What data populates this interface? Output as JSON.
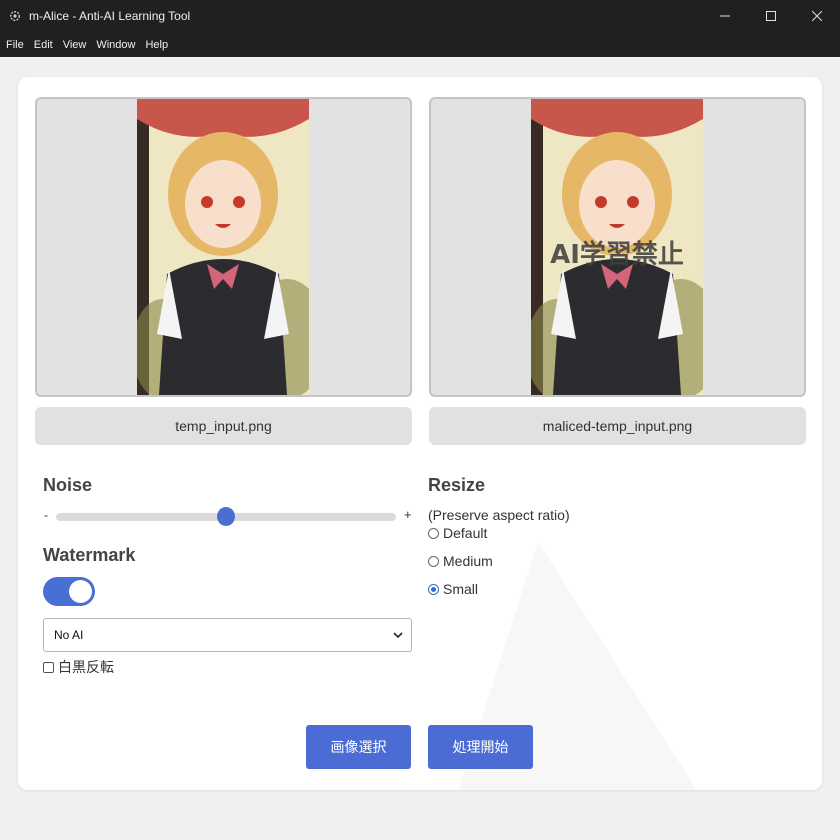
{
  "window": {
    "title": "m-Alice - Anti-AI Learning Tool"
  },
  "menu": [
    "File",
    "Edit",
    "View",
    "Window",
    "Help"
  ],
  "images": {
    "input_label": "temp_input.png",
    "output_label": "maliced-temp_input.png",
    "overlay_text": "AI学習禁止"
  },
  "noise": {
    "title": "Noise",
    "min_label": "-",
    "max_label": "+",
    "value_fraction": 0.5
  },
  "watermark": {
    "title": "Watermark",
    "enabled": true,
    "selected": "No AI",
    "invert_label": "白黒反転",
    "invert_checked": false
  },
  "resize": {
    "title": "Resize",
    "note": "(Preserve aspect ratio)",
    "options": [
      {
        "label": "Default",
        "checked": false
      },
      {
        "label": "Medium",
        "checked": false
      },
      {
        "label": "Small",
        "checked": true
      }
    ]
  },
  "buttons": {
    "select_image": "画像選択",
    "start_processing": "処理開始"
  },
  "colors": {
    "accent": "#4a6cd4",
    "titlebar": "#202020",
    "surface": "#ffffff"
  }
}
